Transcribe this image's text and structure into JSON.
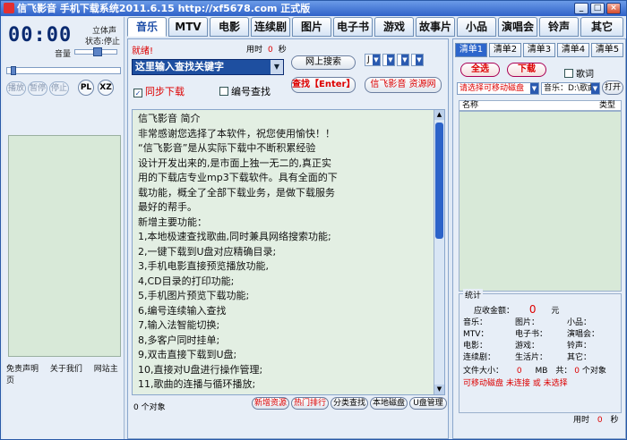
{
  "window": {
    "title": "信飞影音 手机下载系统2011.6.15 http://xf5678.com 正式版"
  },
  "player": {
    "time": "00:00",
    "stereo": "立体声",
    "state": "状态:停止",
    "volume_label": "音量",
    "buttons": [
      "播放",
      "暂停",
      "停止"
    ],
    "pl": "PL",
    "xz": "XZ",
    "links": [
      "免责声明",
      "关于我们",
      "网站主页"
    ]
  },
  "tabs": [
    "音乐",
    "MTV",
    "电影",
    "连续剧",
    "图片",
    "电子书",
    "游戏",
    "故事片",
    "小品",
    "演唱会",
    "铃声",
    "其它"
  ],
  "search": {
    "status": "就绪!",
    "used_label": "用时",
    "used_value": "0",
    "used_unit": "秒",
    "input_value": "这里输入查找关键字",
    "online_search": "网上搜索",
    "find_button": "查找【Enter】",
    "resource_button": "信飞影音 资源网",
    "sync_download": "同步下载",
    "number_search": "编号查找",
    "dd1": "J",
    "dd2": "",
    "dd3": "",
    "dd4": ""
  },
  "content": {
    "lines": [
      "        信飞影音 简介",
      "非常感谢您选择了本软件，祝您使用愉快！！",
      "  “信飞影音”是从实际下载中不断积累经验",
      "设计开发出来的,是市面上独一无二的,真正实",
      "用的下载店专业mp3下载软件。具有全面的下",
      "载功能，概全了全部下载业务，是做下载服务",
      "最好的帮手。",
      "    新增主要功能：",
      "1,本地极速查找歌曲,同时兼具网络搜索功能;",
      "2,一键下载到U盘对应精确目录;",
      "3,手机电影直接预览播放功能,",
      "4,CD目录的打印功能;",
      "5,手机图片预览下载功能;",
      "6,编号连续输入查找",
      "7,输入法智能切换;",
      "8,多客户同时挂单;",
      "9,双击直接下载到U盘;",
      "10,直接对U盘进行操作管理;",
      "11,歌曲的连播与循环播放;"
    ]
  },
  "bottom": {
    "objects": "0  个对象",
    "buttons": [
      "新增资源",
      "热门排行",
      "分类查找",
      "本地磁盘",
      "U盘管理"
    ]
  },
  "right": {
    "lists": [
      "清单1",
      "清单2",
      "清单3",
      "清单4",
      "清单5"
    ],
    "select_all": "全选",
    "download": "下载",
    "lyrics": "歌词",
    "disk_prompt": "请选择可移动磁盘",
    "music_path": "音乐：D:\\歌曲",
    "open": "打开",
    "col_name": "名称",
    "col_type": "类型",
    "stats_title": "统计",
    "receivable_label": "应收金额：",
    "receivable_value": "0",
    "yuan": "元",
    "r1": [
      "音乐：",
      "图片：",
      "小品："
    ],
    "r2": [
      "MTV：",
      "电子书：",
      "演唱会："
    ],
    "r3": [
      "电影：",
      "游戏：",
      "铃声："
    ],
    "r4": [
      "连续剧：",
      "生活片：",
      "其它："
    ],
    "filesize_label": "文件大小：",
    "filesize_value": "0",
    "mb": "MB",
    "common": "共：",
    "count_value": "0",
    "count_unit": "个对象",
    "removable": "可移动磁盘",
    "not_connected": "未连接",
    "or": "或",
    "not_selected": "未选择",
    "used_label": "用时",
    "used_value": "0",
    "used_unit": "秒"
  }
}
